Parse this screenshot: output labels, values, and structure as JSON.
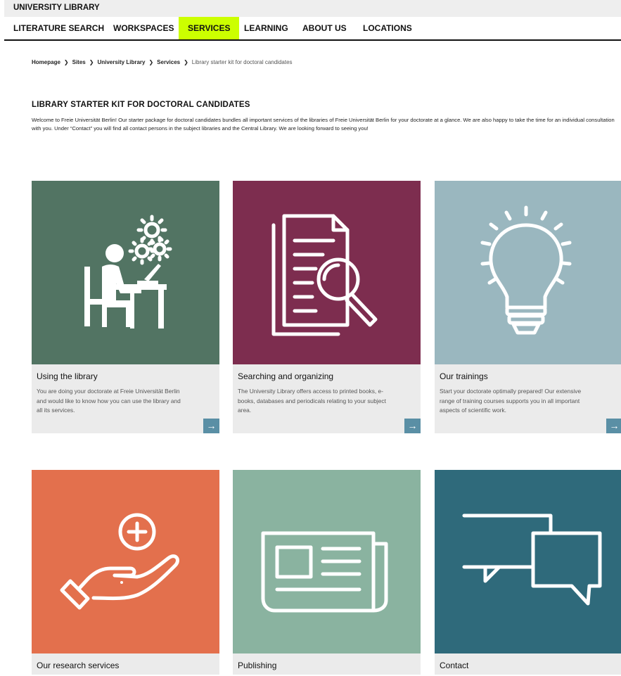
{
  "header": {
    "site_title": "UNIVERSITY LIBRARY"
  },
  "nav": {
    "items": [
      {
        "label": "LITERATURE SEARCH"
      },
      {
        "label": "WORKSPACES"
      },
      {
        "label": "SERVICES",
        "active": true
      },
      {
        "label": "LEARNING"
      },
      {
        "label": "ABOUT US"
      },
      {
        "label": "LOCATIONS"
      }
    ],
    "active_color": "#ccff00"
  },
  "breadcrumb": {
    "items": [
      "Homepage",
      "Sites",
      "University Library",
      "Services"
    ],
    "current": "Library starter kit for doctoral candidates",
    "separator": "❯"
  },
  "main": {
    "title": "LIBRARY STARTER KIT FOR DOCTORAL CANDIDATES",
    "intro": "Welcome to Freie Universität Berlin! Our starter package for doctoral candidates bundles all important services of the libraries of Freie Universität Berlin for your doctorate at a glance. We are also happy to take the time for an individual consultation with you. Under “Contact” you will find all contact persons in the subject libraries and the Central Library. We are looking forward to seeing you!"
  },
  "cards": [
    {
      "title": "Using the library",
      "description": "You are doing your doctorate at Freie Universität Berlin and would like to know how you can use the library and all its services.",
      "color": "#527463",
      "icon": "person-at-desk-gears-icon",
      "arrow": "→"
    },
    {
      "title": "Searching and organizing",
      "description": "The University Library offers access to printed books, e-books, databases and periodicals relating to your subject area.",
      "color": "#7d2d4f",
      "icon": "document-magnifier-icon",
      "arrow": "→"
    },
    {
      "title": "Our trainings",
      "description": "Start your doctorate optimally prepared! Our extensive range of training courses supports you in all important aspects of scientific work.",
      "color": "#9ab7bf",
      "icon": "lightbulb-icon",
      "arrow": "→"
    },
    {
      "title": "Our research services",
      "color": "#e3704d",
      "icon": "hand-plus-icon"
    },
    {
      "title": "Publishing",
      "color": "#8ab3a0",
      "icon": "newspaper-icon"
    },
    {
      "title": "Contact",
      "color": "#2f6a7b",
      "icon": "speech-bubbles-icon"
    }
  ],
  "colors": {
    "arrow_button": "#5a8fa5",
    "card_body": "#ebebeb"
  }
}
